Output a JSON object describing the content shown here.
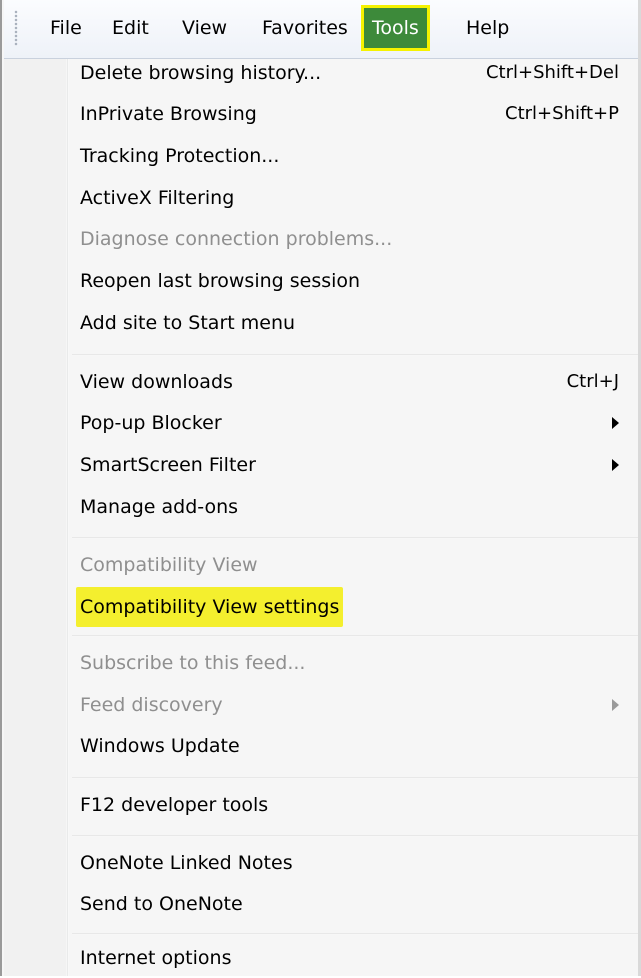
{
  "menubar": {
    "items": [
      "File",
      "Edit",
      "View",
      "Favorites",
      "Tools",
      "Help"
    ],
    "active": "Tools"
  },
  "menu": {
    "items": [
      {
        "label": "Delete browsing history...",
        "shortcut": "Ctrl+Shift+Del"
      },
      {
        "label": "InPrivate Browsing",
        "shortcut": "Ctrl+Shift+P"
      },
      {
        "label": "Tracking Protection..."
      },
      {
        "label": "ActiveX Filtering"
      },
      {
        "label": "Diagnose connection problems...",
        "disabled": true
      },
      {
        "label": "Reopen last browsing session"
      },
      {
        "label": "Add site to Start menu"
      },
      {
        "label": "View downloads",
        "shortcut": "Ctrl+J"
      },
      {
        "label": "Pop-up Blocker",
        "submenu": true
      },
      {
        "label": "SmartScreen Filter",
        "submenu": true
      },
      {
        "label": "Manage add-ons"
      },
      {
        "label": "Compatibility View",
        "disabled": true
      },
      {
        "label": "Compatibility View settings",
        "highlighted": true
      },
      {
        "label": "Subscribe to this feed...",
        "disabled": true
      },
      {
        "label": "Feed discovery",
        "disabled": true,
        "submenu": true
      },
      {
        "label": "Windows Update"
      },
      {
        "label": "F12 developer tools"
      },
      {
        "label": "OneNote Linked Notes"
      },
      {
        "label": "Send to OneNote"
      },
      {
        "label": "Internet options"
      }
    ]
  },
  "colors": {
    "highlight": "#f4ef2e",
    "active_menu_bg": "#3d8a3a",
    "disabled_text": "#8f8f8f"
  }
}
